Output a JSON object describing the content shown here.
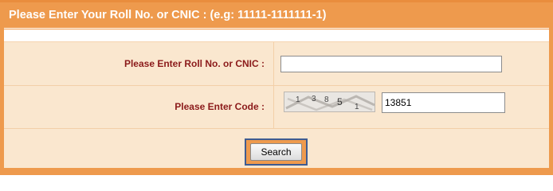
{
  "header": {
    "title": "Please Enter Your Roll No. or CNIC : (e.g: 11111-1111111-1)"
  },
  "form": {
    "roll_label": "Please Enter Roll No. or CNIC :",
    "roll_value": "",
    "code_label": "Please Enter Code :",
    "code_value": "13851",
    "captcha_digits": [
      "1",
      "3",
      "8",
      "5",
      "1"
    ],
    "search_label": "Search"
  }
}
